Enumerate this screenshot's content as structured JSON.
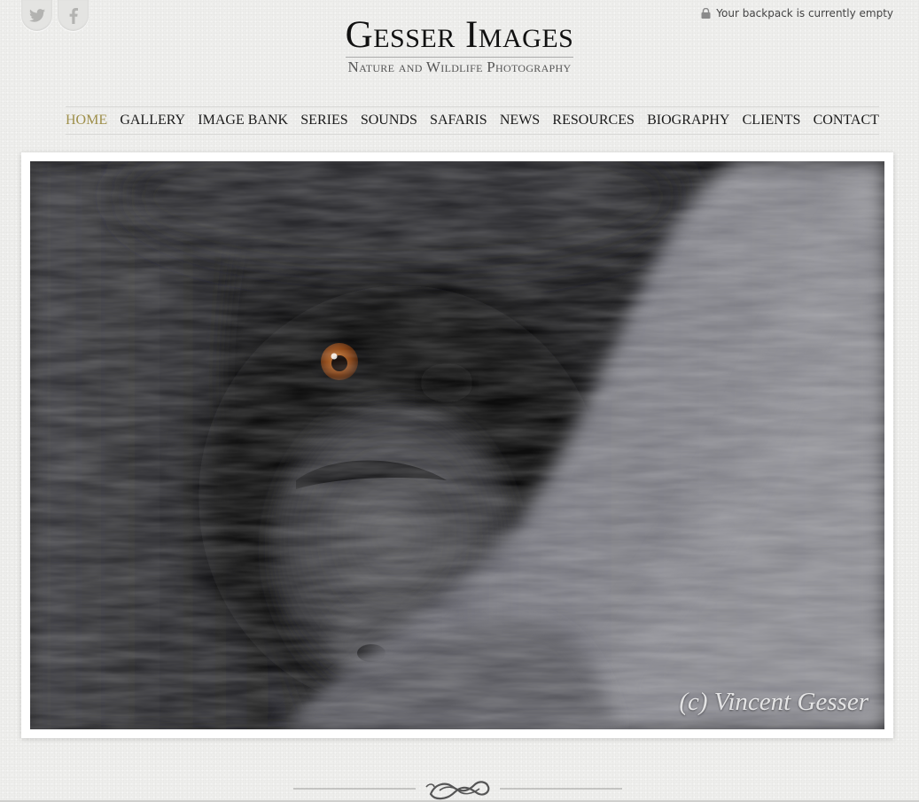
{
  "social": {
    "items": [
      {
        "icon": "twitter-icon"
      },
      {
        "icon": "facebook-icon"
      }
    ]
  },
  "backpack": {
    "text": "Your backpack is currently empty",
    "icon": "lock-icon"
  },
  "logo": {
    "title": "Gesser Images",
    "subtitle": "Nature and Wildlife Photography"
  },
  "nav": {
    "items": [
      {
        "label": "HOME",
        "active": true
      },
      {
        "label": "GALLERY"
      },
      {
        "label": "IMAGE BANK"
      },
      {
        "label": "SERIES"
      },
      {
        "label": "SOUNDS"
      },
      {
        "label": "SAFARIS"
      },
      {
        "label": "NEWS"
      },
      {
        "label": "RESOURCES"
      },
      {
        "label": "BIOGRAPHY"
      },
      {
        "label": "CLIENTS"
      },
      {
        "label": "CONTACT"
      }
    ],
    "active_color": "#9e8f4a"
  },
  "hero": {
    "watermark": "(c) Vincent Gesser"
  }
}
